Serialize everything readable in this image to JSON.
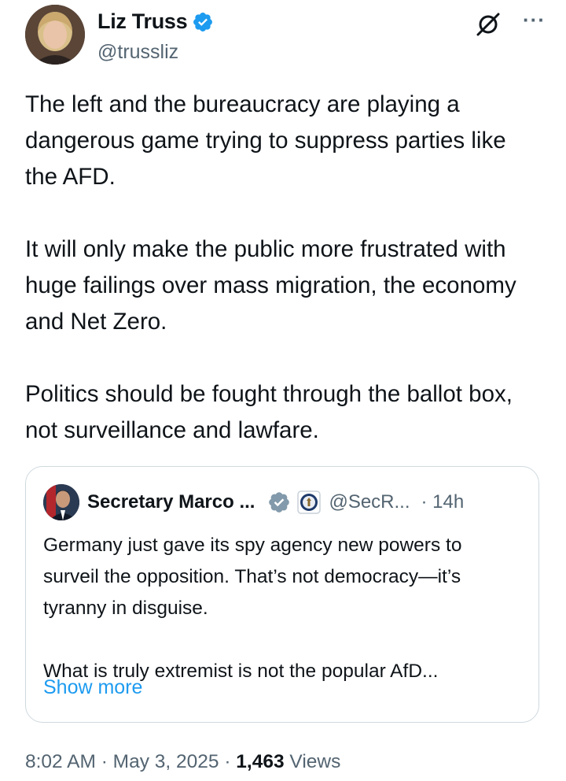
{
  "author": {
    "name": "Liz Truss",
    "handle": "@trussliz",
    "verified": true,
    "avatar_icon": "liz-truss-avatar"
  },
  "actions": {
    "grok_icon": "grok-icon",
    "more_label": "···"
  },
  "tweet": {
    "paragraphs": [
      "The left and the bureaucracy are playing a dangerous game trying to suppress parties like the AFD.",
      "It will only make the public more frustrated with huge failings over mass migration, the economy and Net Zero.",
      "Politics should be fought through the ballot box, not surveillance and lawfare."
    ]
  },
  "quoted": {
    "name": "Secretary Marco ...",
    "handle": "@SecR...",
    "time": "· 14h",
    "verified_color": "#829aab",
    "paragraph1": "Germany just gave its spy agency new powers to surveil the opposition.  That’s not democracy—it’s tyranny in disguise.",
    "paragraph2": "What is truly extremist is not the popular AfD...",
    "show_more": "Show more"
  },
  "meta": {
    "time": "8:02 AM",
    "sep1": " · ",
    "date": "May 3, 2025",
    "sep2": " · ",
    "views_count": "1,463",
    "views_label": " Views"
  },
  "colors": {
    "verified_blue": "#1d9bf0",
    "link": "#1d9bf0",
    "secondary_text": "#536471"
  }
}
